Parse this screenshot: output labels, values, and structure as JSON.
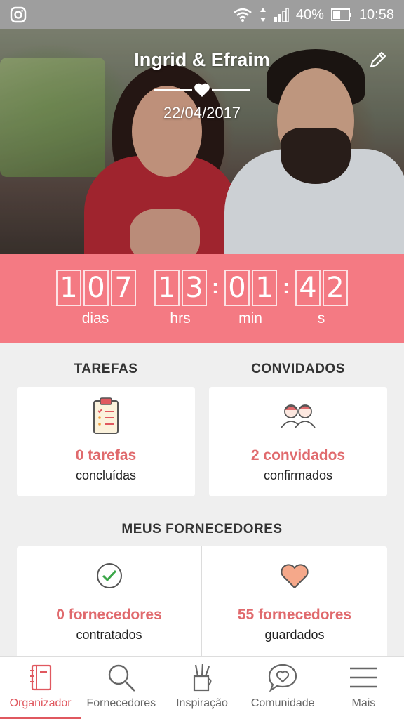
{
  "status_bar": {
    "battery": "40%",
    "time": "10:58",
    "icons": [
      "instagram-icon",
      "wifi-icon",
      "data-arrows-icon",
      "signal-icon",
      "battery-icon"
    ]
  },
  "hero": {
    "couple": "Ingrid & Efraim",
    "date": "22/04/2017",
    "icons": [
      "heart-icon",
      "pencil-icon"
    ]
  },
  "countdown": {
    "days": [
      "1",
      "0",
      "7"
    ],
    "hours": [
      "1",
      "3"
    ],
    "minutes": [
      "0",
      "1"
    ],
    "seconds": [
      "4",
      "2"
    ],
    "labels": {
      "days": "dias",
      "hours": "hrs",
      "minutes": "min",
      "seconds": "s"
    }
  },
  "tasks": {
    "title": "TAREFAS",
    "count": "0 tarefas",
    "status": "concluídas",
    "icon": "clipboard-icon"
  },
  "guests": {
    "title": "CONVIDADOS",
    "count": "2 convidados",
    "status": "confirmados",
    "icon": "guests-icon"
  },
  "vendors": {
    "title": "MEUS FORNECEDORES",
    "hired": {
      "count": "0 fornecedores",
      "status": "contratados",
      "icon": "check-circle-icon"
    },
    "saved": {
      "count": "55 fornecedores",
      "status": "guardados",
      "icon": "heart-icon"
    }
  },
  "tabs": [
    {
      "label": "Organizador",
      "icon": "notebook-icon",
      "active": true
    },
    {
      "label": "Fornecedores",
      "icon": "search-icon",
      "active": false
    },
    {
      "label": "Inspiração",
      "icon": "pencil-cup-icon",
      "active": false
    },
    {
      "label": "Comunidade",
      "icon": "chat-heart-icon",
      "active": false
    },
    {
      "label": "Mais",
      "icon": "menu-icon",
      "active": false
    }
  ],
  "colors": {
    "accent": "#f47a83",
    "accent_text": "#e06a6d",
    "tab_active": "#e0585f",
    "status_bar": "#9e9e9e"
  }
}
